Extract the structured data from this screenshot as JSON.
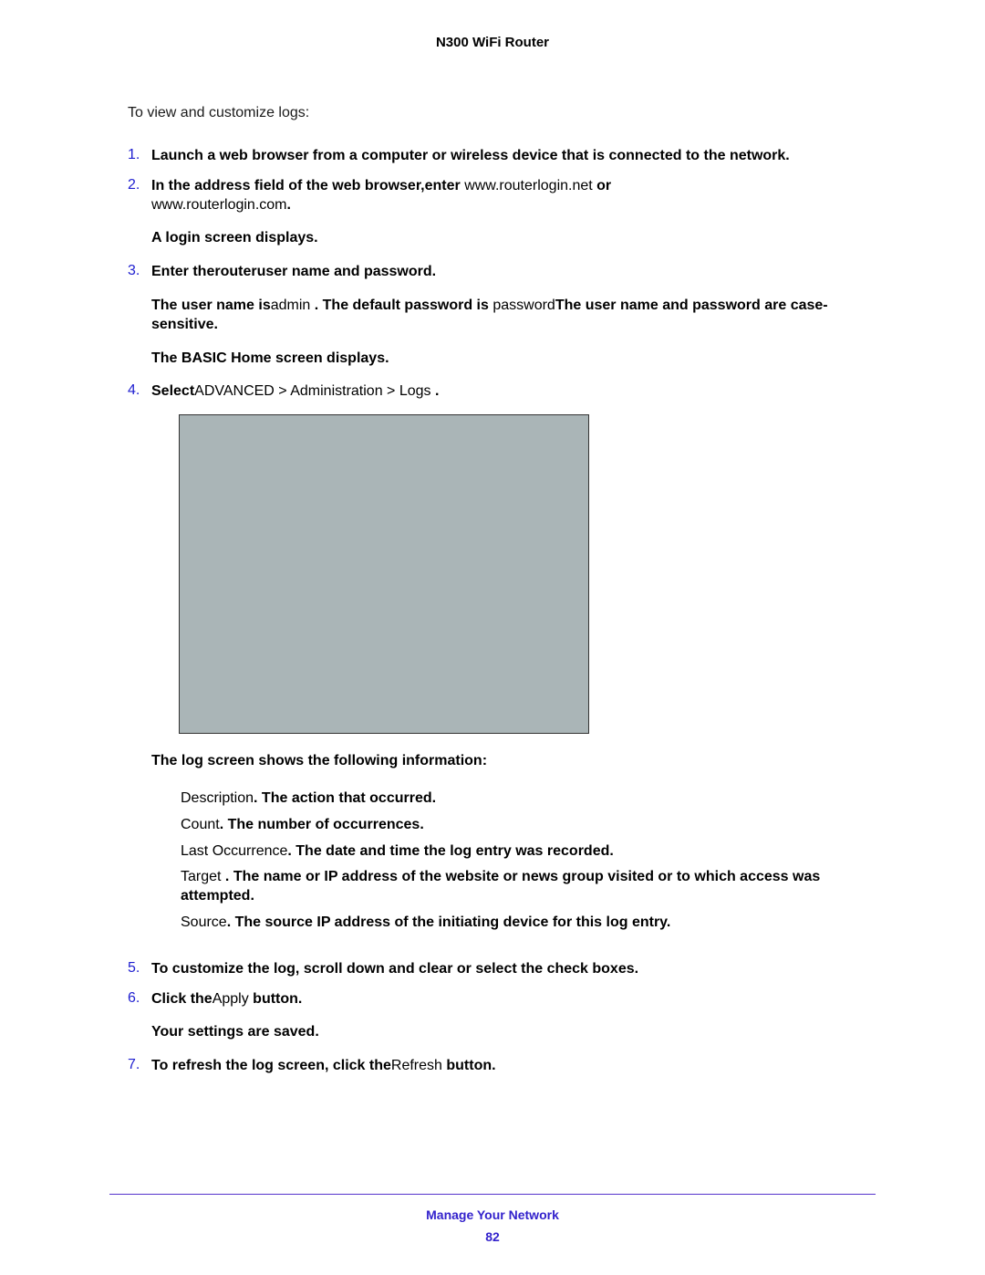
{
  "header": {
    "title": "N300 WiFi Router"
  },
  "intro": "To view and customize logs:",
  "steps": {
    "s1": {
      "num": "1.",
      "text": "Launch a web browser from a computer or wireless device that is connected to the network."
    },
    "s2": {
      "num": "2.",
      "prefix": "In the address field of the web browser,",
      "enter": "enter",
      "url1": " www.routerlogin.net ",
      "or": " or ",
      "url2": "www.routerlogin.com",
      "dot": ".",
      "login": "A login screen displays."
    },
    "s3": {
      "num": "3.",
      "line1a": "Enter the",
      "line1b": "router",
      "line1c": "user name and password.",
      "line2a": "The user name is",
      "line2b": "admin ",
      "line2c": ". The default password is ",
      "line2d": "password",
      "line2e": "The user name and password are case-sensitive.",
      "line3": "The BASIC Home screen displays."
    },
    "s4": {
      "num": "4.",
      "select": "Select",
      "path": "ADVANCED > Administration > Logs ",
      "dot": " .",
      "logintro": "The log screen shows the following information:"
    },
    "logitems": {
      "i1": {
        "term": "Description",
        "dot": ".   ",
        "desc": "The action that occurred."
      },
      "i2": {
        "term": "Count",
        "dot": ".  ",
        "desc": "The number of occurrences."
      },
      "i3": {
        "term": "Last Occurrence",
        "dot": ".   ",
        "desc": "The date and time the log entry was recorded."
      },
      "i4": {
        "term": "Target",
        "dot": " . ",
        "desc": "The name or IP address of the website or news group visited or to which access was attempted."
      },
      "i5": {
        "term": "Source",
        "dot": ".  ",
        "desc": "The source IP address of the initiating device for this log entry."
      }
    },
    "s5": {
      "num": "5.",
      "text": "To customize the log, scroll down and clear or select the check boxes."
    },
    "s6": {
      "num": "6.",
      "a": "Click the",
      "b": "Apply",
      "c": " button.",
      "saved": "Your settings are saved."
    },
    "s7": {
      "num": "7.",
      "a": "To refresh the log screen, click the",
      "b": "Refresh",
      "c": " button."
    }
  },
  "footer": {
    "section": "Manage Your Network",
    "page": "82"
  }
}
